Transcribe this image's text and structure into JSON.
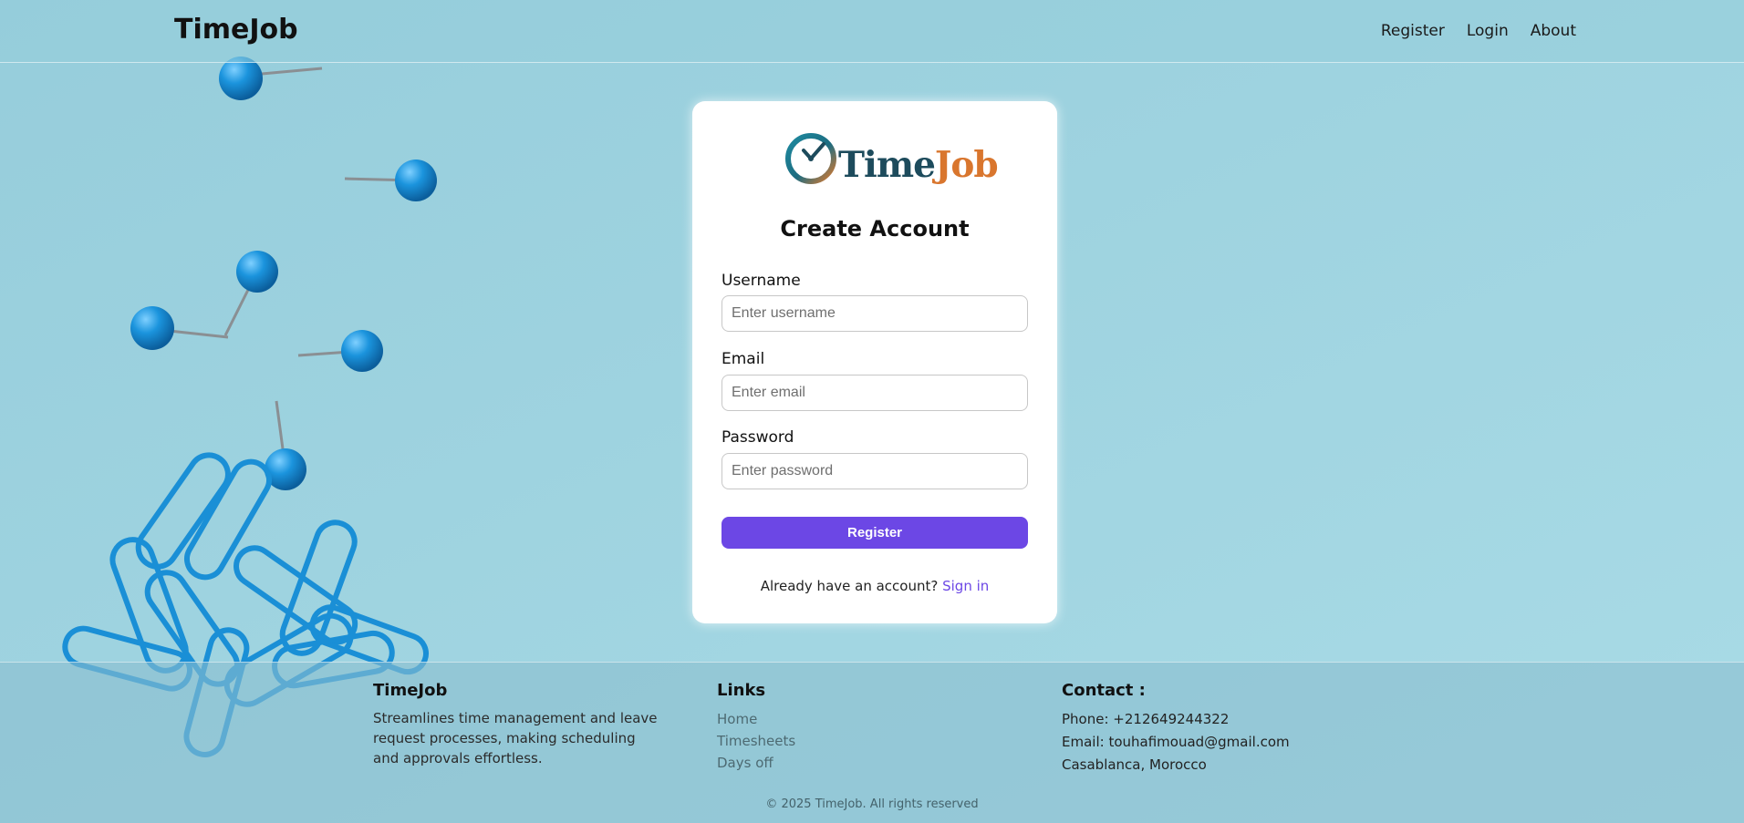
{
  "navbar": {
    "brand": "TimeJob",
    "links": [
      "Register",
      "Login",
      "About"
    ]
  },
  "card": {
    "logo_text_main": "Time",
    "logo_text_accent": "Job",
    "title": "Create Account",
    "fields": [
      {
        "label": "Username",
        "placeholder": "Enter username",
        "value": ""
      },
      {
        "label": "Email",
        "placeholder": "Enter email",
        "value": ""
      },
      {
        "label": "Password",
        "placeholder": "Enter password",
        "value": ""
      }
    ],
    "submit_label": "Register",
    "signin_prompt": "Already have an account?",
    "signin_link": "Sign in"
  },
  "footer": {
    "about": {
      "heading": "TimeJob",
      "text": "Streamlines time management and leave request processes, making scheduling and approvals effortless."
    },
    "links": {
      "heading": "Links",
      "items": [
        "Home",
        "Timesheets",
        "Days off"
      ]
    },
    "contact": {
      "heading": "Contact :",
      "phone": "Phone: +212649244322",
      "email": "Email: touhafimouad@gmail.com",
      "address": "Casablanca, Morocco"
    },
    "copyright": "© 2025 TimeJob. All rights reserved"
  },
  "colors": {
    "background": "#9fd3df",
    "accent": "#6c47e5",
    "pin": "#1a8fd6",
    "logo_dark": "#1d4b5c",
    "logo_orange": "#d9762e"
  }
}
